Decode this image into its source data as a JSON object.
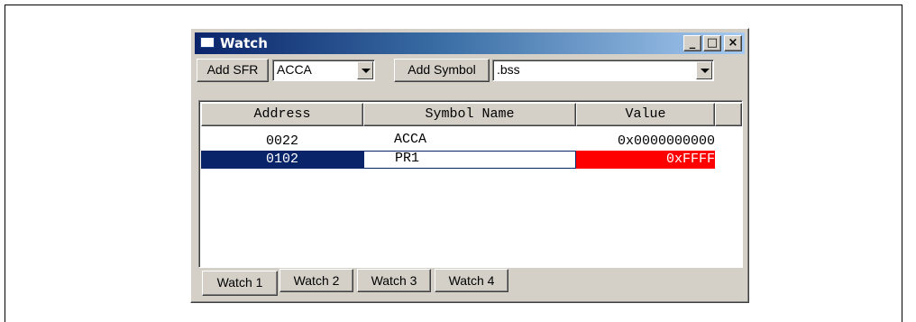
{
  "window": {
    "title": "Watch",
    "controls": {
      "minimize": "_",
      "maximize": "□",
      "close": "×"
    }
  },
  "toolbar": {
    "add_sfr_label": "Add SFR",
    "sfr_value": "ACCA",
    "add_symbol_label": "Add Symbol",
    "symbol_value": ".bss"
  },
  "table": {
    "columns": [
      "Address",
      "Symbol Name",
      "Value"
    ],
    "rows": [
      {
        "address": "0022",
        "symbol": "ACCA",
        "value": "0x0000000000",
        "selected": false
      },
      {
        "address": "0102",
        "symbol": "PR1",
        "value": "0xFFFF",
        "selected": true
      }
    ]
  },
  "tabs": [
    "Watch 1",
    "Watch 2",
    "Watch 3",
    "Watch 4"
  ],
  "colors": {
    "selection": "#0a246a",
    "changed_value": "#ff0000"
  }
}
